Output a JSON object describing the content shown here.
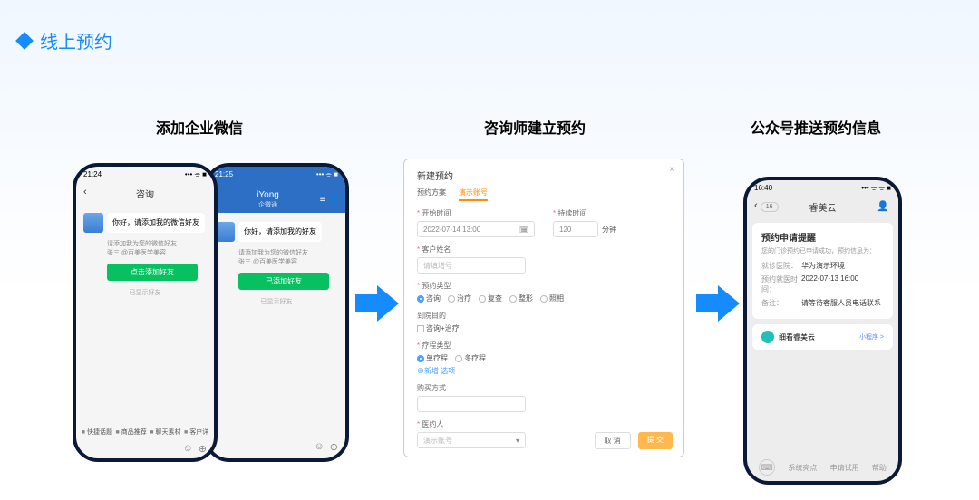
{
  "title": "线上预约",
  "steps": {
    "s1": "添加企业微信",
    "s2": "咨询师建立预约",
    "s3": "公众号推送预约信息"
  },
  "phoneA": {
    "time": "21:24",
    "signal": "••• ⌯ ■",
    "header": "咨询",
    "bubble": "你好，请添加我的微信好友",
    "subtext_l1": "请添加我为您的微信好友",
    "subtext_l2": "张三 @百美医学美容",
    "button": "点击添加好友",
    "history": "已显示好友",
    "nav": {
      "a": "快捷话题",
      "b": "商品推荐",
      "c": "聊天素材",
      "d": "客户详"
    }
  },
  "phoneB": {
    "time": "21:25",
    "signal": "••• ⌯ ■",
    "app": "iYong",
    "sub": "企微通",
    "bubble": "你好，请添加我的好友",
    "subtext_l1": "请添加我为您的微信好友",
    "subtext_l2": "张三 @百美医学美容",
    "button": "已添加好友",
    "history": "已显示好友"
  },
  "modal": {
    "title": "新建预约",
    "tab1": "预约方案",
    "tab2": "演示账号",
    "start_label": "开始时间",
    "start_value": "2022-07-14 13:00",
    "dur_label": "持续时间",
    "dur_value": "120",
    "dur_unit": "分钟",
    "cust_label": "客户姓名",
    "cust_placeholder": "请填增号",
    "type_label": "预约类型",
    "types": [
      "咨询",
      "治疗",
      "复查",
      "整形",
      "照相"
    ],
    "purpose_label": "到院目的",
    "purpose_v": "咨询+治疗",
    "step_label": "疗程类型",
    "step_opts": [
      "单疗程",
      "多疗程"
    ],
    "add_opt": "⊕新增 选项",
    "pay_label": "购买方式",
    "doctor_label": "医约人",
    "doctor_ph": "演示账号",
    "cancel": "取 消",
    "submit": "提 交"
  },
  "phoneC": {
    "time": "16:40",
    "signal": "••• ⌯ ⌯ ■",
    "back_badge": "16",
    "header": "睿美云",
    "card_title": "预约申请提醒",
    "card_sub": "您的门诊预约已申请成功，预约信息为：",
    "k1": "就诊医院：",
    "v1": "华为演示环境",
    "k2": "预约就医时间：",
    "v2": "2022-07-13 16:00",
    "k3": "备注：",
    "v3": "请等待客服人员电话联系",
    "mini_name": "细看睿美云",
    "mini_tag": "小程序 >",
    "footer": {
      "a": "系统亮点",
      "b": "申请试用",
      "c": "帮助"
    }
  }
}
